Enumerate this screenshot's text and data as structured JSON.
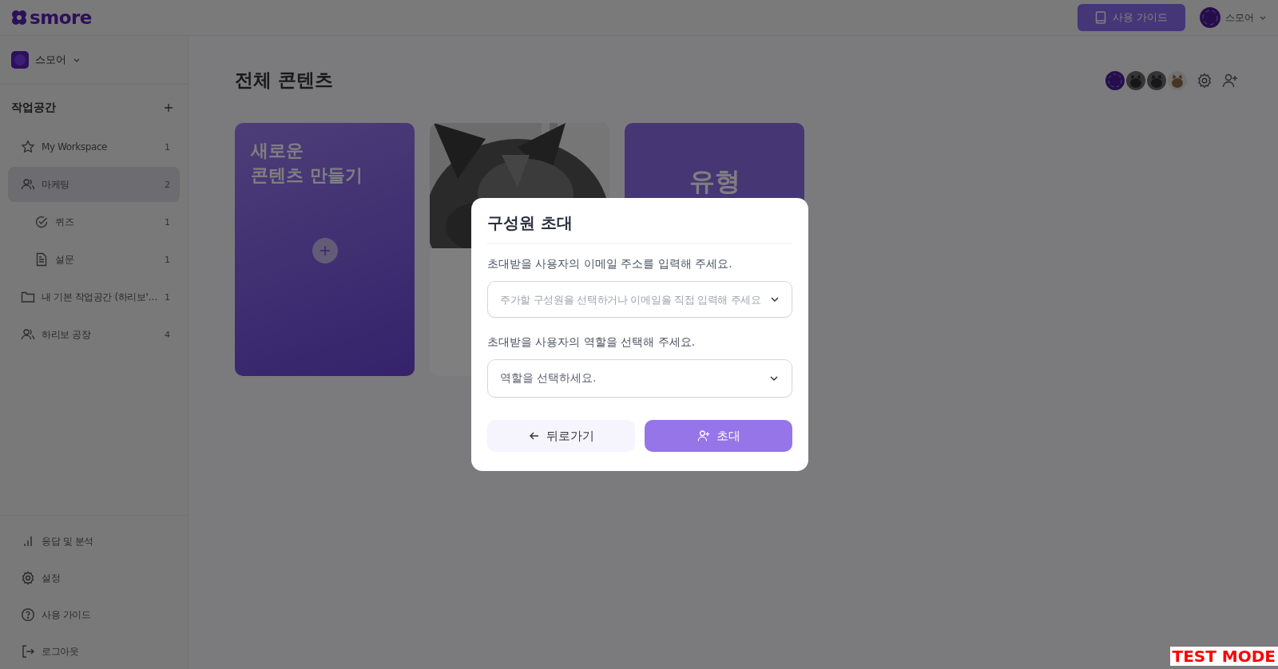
{
  "header": {
    "logo": "smore",
    "guide_button": "사용 가이드",
    "user": {
      "name": "스모어"
    }
  },
  "sidebar": {
    "team": {
      "name": "스모어"
    },
    "section_title": "작업공간",
    "items": [
      {
        "kind": "star",
        "label": "My Workspace",
        "count": "1",
        "selected": false
      },
      {
        "kind": "group",
        "label": "마케팅",
        "count": "2",
        "selected": true,
        "children": [
          {
            "kind": "quiz",
            "label": "퀴즈",
            "count": "1",
            "selected": false
          },
          {
            "kind": "survey",
            "label": "설문",
            "count": "1",
            "selected": false
          }
        ]
      },
      {
        "kind": "folder",
        "label": "내 기본 작업공간 (하리보'…",
        "count": "1",
        "selected": false
      },
      {
        "kind": "group",
        "label": "하리보 공장",
        "count": "4",
        "selected": false
      }
    ],
    "bottom_menu": [
      {
        "kind": "chart",
        "label": "응답 및 분석"
      },
      {
        "kind": "settings",
        "label": "설정"
      },
      {
        "kind": "help",
        "label": "사용 가이드"
      },
      {
        "kind": "logout",
        "label": "로그아웃"
      }
    ]
  },
  "main": {
    "title": "전체 콘텐츠",
    "members": [
      {
        "kind": "logo"
      },
      {
        "kind": "picture"
      },
      {
        "kind": "picture"
      },
      {
        "kind": "picture"
      }
    ],
    "cards": [
      {
        "kind": "create",
        "title": "새로운\n콘텐츠 만들기"
      },
      {
        "kind": "picture"
      },
      {
        "kind": "type",
        "title": "유형"
      }
    ]
  },
  "modal": {
    "title": "구성원 초대",
    "email_label": "초대받을 사용자의 이메일 주소를 입력해 주세요.",
    "email_placeholder": "주가할 구성원을 선택하거나 이메일을 직접 입력해 주세요",
    "role_label": "초대받을 사용자의 역할을 선택해 주세요.",
    "role_placeholder": "역할을 선택하세요.",
    "back_button": "뒤로가기",
    "invite_button": "초대"
  },
  "test_mode": "TEST MODE"
}
